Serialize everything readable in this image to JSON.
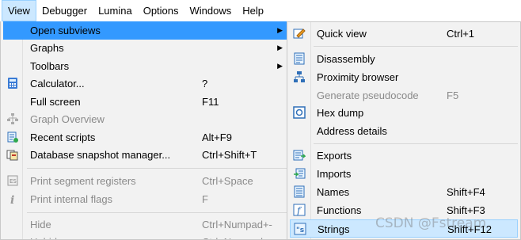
{
  "menubar": {
    "items": [
      {
        "label": "View",
        "active": true
      },
      {
        "label": "Debugger"
      },
      {
        "label": "Lumina"
      },
      {
        "label": "Options"
      },
      {
        "label": "Windows"
      },
      {
        "label": "Help"
      }
    ]
  },
  "view_menu": {
    "items": [
      {
        "label": "Open subviews",
        "submenu": true
      },
      {
        "label": "Graphs",
        "submenu": true
      },
      {
        "label": "Toolbars",
        "submenu": true
      },
      {
        "label": "Calculator...",
        "shortcut": "?",
        "icon": "calculator-icon"
      },
      {
        "label": "Full screen",
        "shortcut": "F11"
      },
      {
        "label": "Graph Overview",
        "disabled": true,
        "icon": "graph-overview-icon"
      },
      {
        "label": "Recent scripts",
        "shortcut": "Alt+F9",
        "icon": "recent-scripts-icon"
      },
      {
        "label": "Database snapshot manager...",
        "shortcut": "Ctrl+Shift+T",
        "icon": "snapshot-icon"
      },
      {
        "label": "Print segment registers",
        "shortcut": "Ctrl+Space",
        "disabled": true,
        "icon": "segment-registers-icon"
      },
      {
        "label": "Print internal flags",
        "shortcut": "F",
        "disabled": true,
        "icon": "info-icon"
      },
      {
        "label": "Hide",
        "shortcut": "Ctrl+Numpad+-",
        "disabled": true
      },
      {
        "label": "Unhide",
        "shortcut": "Ctrl+Numpad++",
        "disabled": true
      }
    ]
  },
  "subviews_menu": {
    "items": [
      {
        "label": "Quick view",
        "shortcut": "Ctrl+1",
        "icon": "quick-view-icon"
      },
      {
        "label": "Disassembly",
        "icon": "disassembly-icon"
      },
      {
        "label": "Proximity browser",
        "icon": "proximity-icon"
      },
      {
        "label": "Generate pseudocode",
        "shortcut": "F5",
        "disabled": true
      },
      {
        "label": "Hex dump",
        "icon": "hex-dump-icon"
      },
      {
        "label": "Address details"
      },
      {
        "label": "Exports",
        "icon": "exports-icon"
      },
      {
        "label": "Imports",
        "icon": "imports-icon"
      },
      {
        "label": "Names",
        "shortcut": "Shift+F4",
        "icon": "names-icon"
      },
      {
        "label": "Functions",
        "shortcut": "Shift+F3",
        "icon": "functions-icon"
      },
      {
        "label": "Strings",
        "shortcut": "Shift+F12",
        "icon": "strings-icon",
        "highlighted": true
      }
    ]
  },
  "watermark": "CSDN @Fstream",
  "colors": {
    "highlight_bg": "#cce8ff",
    "highlight_border": "#99d1ff",
    "submenu_active": "#3399ff",
    "menu_bg": "#f2f2f2"
  }
}
